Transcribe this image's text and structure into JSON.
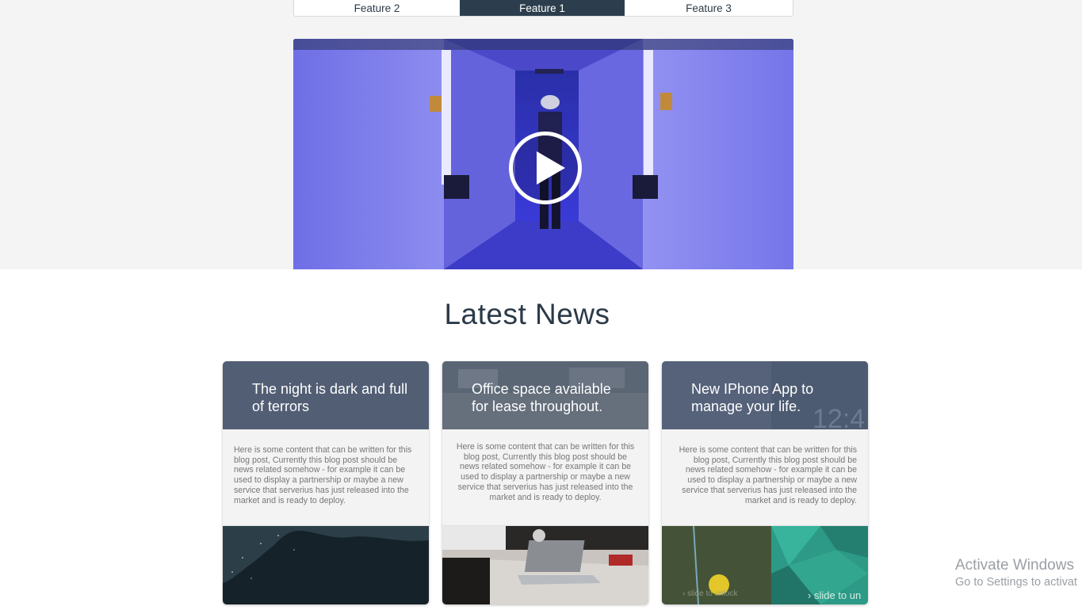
{
  "tabs": [
    {
      "label": "Feature 2"
    },
    {
      "label": "Feature 1",
      "active": true
    },
    {
      "label": "Feature 3"
    }
  ],
  "video": {
    "play_icon": "play-icon"
  },
  "news": {
    "heading": "Latest News",
    "cards": [
      {
        "title": "The night is dark and full of terrors",
        "body": "Here is some content that can be written for this blog post, Currently this blog post should be news related somehow - for example it can be used to display a partnership or maybe a new service that serverius has just released into the market and is ready to deploy."
      },
      {
        "title": "Office space available for lease throughout.",
        "body": "Here is some content that can be written for this blog post, Currently this blog post should be news related somehow - for example it can be used to display a partnership or maybe a new service that serverius has just released into the market and is ready to deploy."
      },
      {
        "title": "New IPhone App to manage your life.",
        "body": "Here is some content that can be written for this blog post, Currently this blog post should be news related somehow - for example it can be used to display a partnership or maybe a new service that serverius has just released into the market and is ready to deploy.",
        "image_text_left": "slide to unlock",
        "image_text_right": "slide to un"
      }
    ]
  },
  "watermark": {
    "line1": "Activate Windows",
    "line2": "Go to Settings to activat"
  },
  "colors": {
    "tab_active_bg": "#2c3e4d",
    "card_header_bg": "#515e74",
    "heading_color": "#2b3a49"
  }
}
